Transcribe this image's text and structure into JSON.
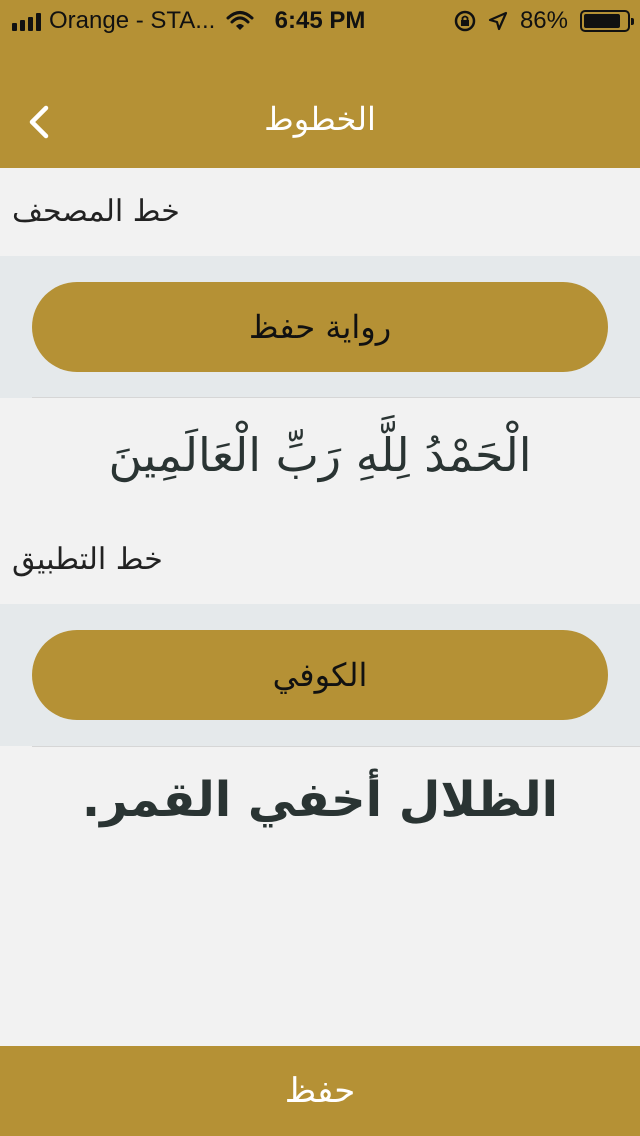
{
  "status_bar": {
    "carrier": "Orange - STA...",
    "time": "6:45 PM",
    "battery": "86%",
    "battery_level": 0.86
  },
  "nav": {
    "title": "الخطوط",
    "back_icon": "chevron-left-icon"
  },
  "sections": [
    {
      "label": "خط المصحف",
      "button_label": "رواية حفظ",
      "sample": "الْحَمْدُ لِلَّهِ رَبِّ الْعَالَمِينَ"
    },
    {
      "label": "خط التطبيق",
      "button_label": "الكوفي",
      "sample": "الظلال أخفي القمر."
    }
  ],
  "save_button": "حفظ",
  "colors": {
    "accent": "#b59135",
    "background": "#f2f2f2",
    "band": "#e5e9eb",
    "text": "#222222"
  }
}
